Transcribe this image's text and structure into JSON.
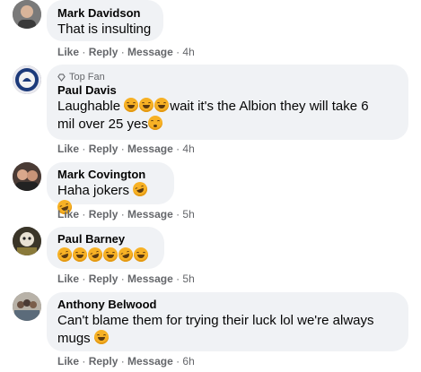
{
  "comments": [
    {
      "author": "Mark Davidson",
      "text": "That is insulting",
      "actions": {
        "like": "Like",
        "reply": "Reply",
        "message": "Message",
        "time": "4h"
      }
    },
    {
      "badge": "Top Fan",
      "author": "Paul Davis",
      "text_a": "Laughable",
      "text_b": "wait it's the Albion they will take 6",
      "text_c": "mil over 25 yes",
      "actions": {
        "like": "Like",
        "reply": "Reply",
        "message": "Message",
        "time": "4h"
      }
    },
    {
      "author": "Mark Covington",
      "text": "Haha jokers",
      "actions": {
        "like": "Like",
        "reply": "Reply",
        "message": "Message",
        "time": "5h"
      }
    },
    {
      "author": "Paul Barney",
      "actions": {
        "like": "Like",
        "reply": "Reply",
        "message": "Message",
        "time": "5h"
      }
    },
    {
      "author": "Anthony Belwood",
      "text_a": "Can't blame them for trying their luck lol we're always",
      "text_b": "mugs",
      "actions": {
        "like": "Like",
        "reply": "Reply",
        "message": "Message",
        "time": "6h"
      }
    }
  ],
  "icons": {
    "emoji": "laughing-tears-emoji",
    "worried": "worried-emoji",
    "top_fan": "diamond-icon"
  },
  "colors": {
    "bubble": "#f0f2f5",
    "secondary_text": "#65676b",
    "emoji": "#f7b125"
  }
}
